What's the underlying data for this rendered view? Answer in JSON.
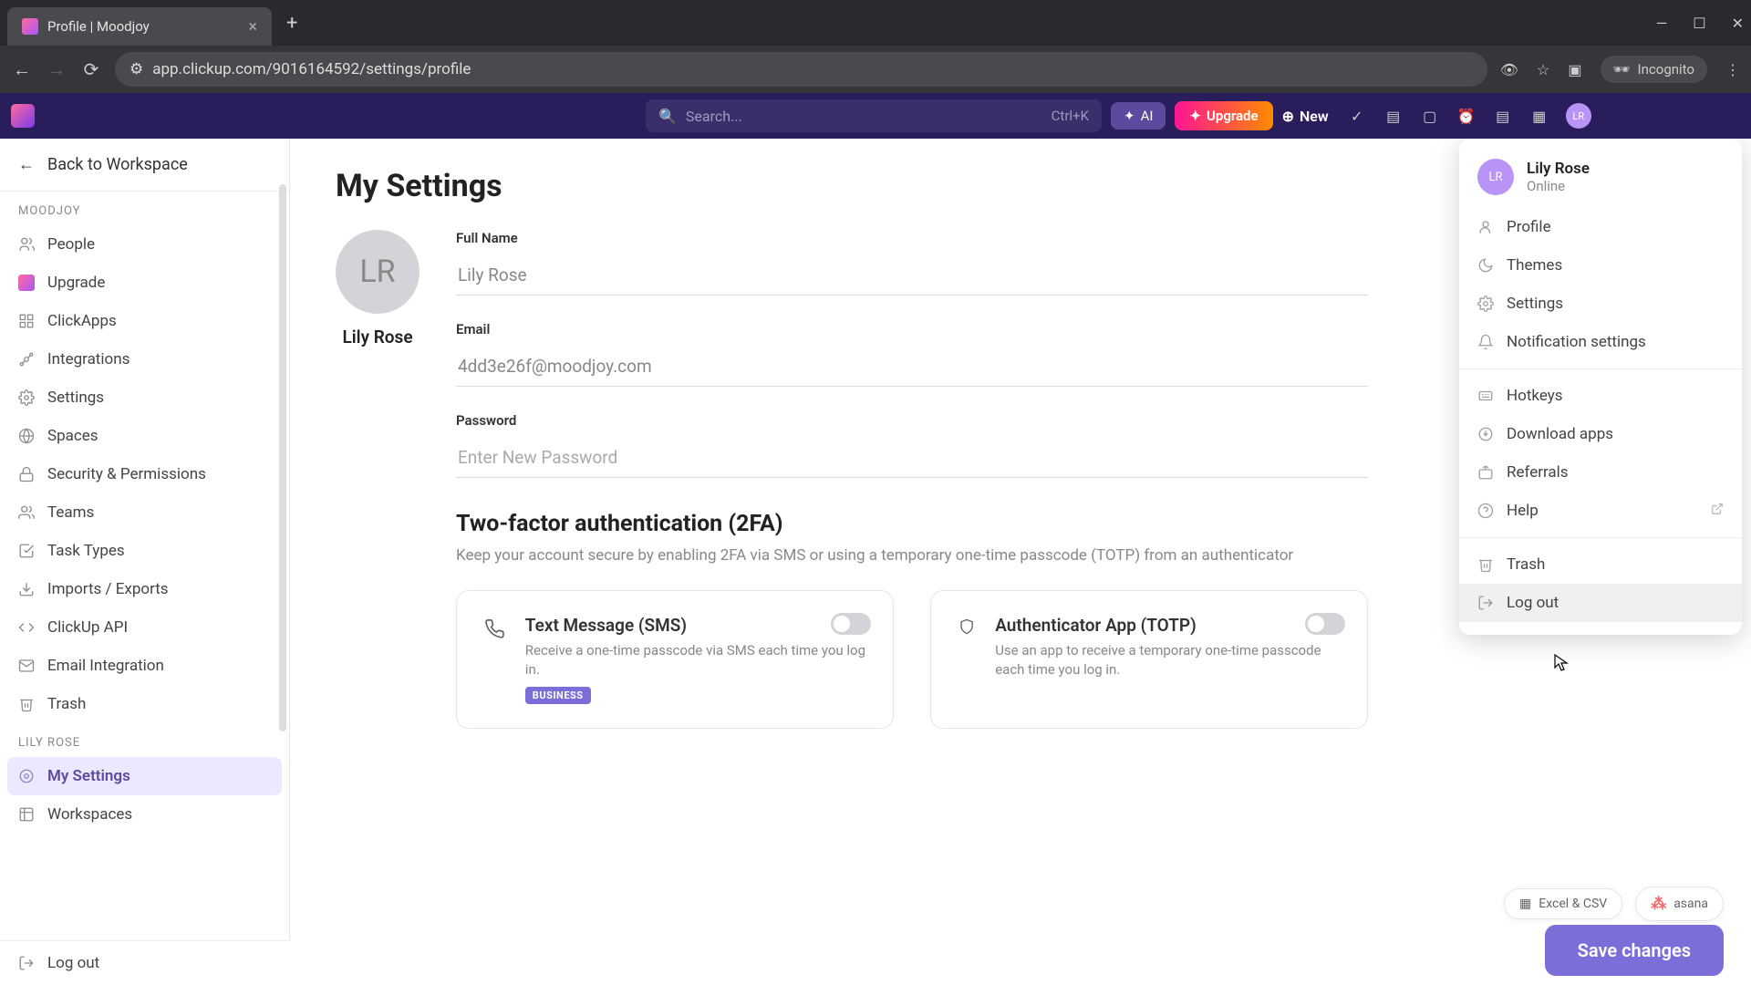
{
  "browser": {
    "tab_title": "Profile | Moodjoy",
    "url": "app.clickup.com/9016164592/settings/profile",
    "incognito_label": "Incognito"
  },
  "topbar": {
    "search_placeholder": "Search...",
    "search_shortcut": "Ctrl+K",
    "ai_label": "AI",
    "upgrade_label": "Upgrade",
    "new_label": "New",
    "avatar_initials": "LR"
  },
  "sidebar": {
    "back_label": "Back to Workspace",
    "section1_title": "MOODJOY",
    "section1_items": [
      {
        "icon": "people",
        "label": "People"
      },
      {
        "icon": "upgrade",
        "label": "Upgrade"
      },
      {
        "icon": "clickapps",
        "label": "ClickApps"
      },
      {
        "icon": "integrations",
        "label": "Integrations"
      },
      {
        "icon": "settings",
        "label": "Settings"
      },
      {
        "icon": "spaces",
        "label": "Spaces"
      },
      {
        "icon": "security",
        "label": "Security & Permissions"
      },
      {
        "icon": "teams",
        "label": "Teams"
      },
      {
        "icon": "task-types",
        "label": "Task Types"
      },
      {
        "icon": "imports",
        "label": "Imports / Exports"
      },
      {
        "icon": "api",
        "label": "ClickUp API"
      },
      {
        "icon": "email",
        "label": "Email Integration"
      },
      {
        "icon": "trash",
        "label": "Trash"
      }
    ],
    "section2_title": "LILY ROSE",
    "section2_items": [
      {
        "icon": "my-settings",
        "label": "My Settings",
        "active": true
      },
      {
        "icon": "workspaces",
        "label": "Workspaces"
      }
    ],
    "logout_label": "Log out"
  },
  "settings": {
    "page_title": "My Settings",
    "avatar_initials": "LR",
    "avatar_name": "Lily Rose",
    "fields": {
      "fullname_label": "Full Name",
      "fullname_value": "Lily Rose",
      "email_label": "Email",
      "email_value": "4dd3e26f@moodjoy.com",
      "password_label": "Password",
      "password_placeholder": "Enter New Password"
    },
    "twofa": {
      "title": "Two-factor authentication (2FA)",
      "description": "Keep your account secure by enabling 2FA via SMS or using a temporary one-time passcode (TOTP) from an authenticator",
      "sms_title": "Text Message (SMS)",
      "sms_desc": "Receive a one-time passcode via SMS each time you log in.",
      "sms_badge": "BUSINESS",
      "totp_title": "Authenticator App (TOTP)",
      "totp_desc": "Use an app to receive a temporary one-time passcode each time you log in."
    },
    "save_label": "Save changes",
    "excel_csv_label": "Excel & CSV",
    "asana_label": "asana"
  },
  "user_menu": {
    "avatar_initials": "LR",
    "name": "Lily Rose",
    "status": "Online",
    "items1": [
      {
        "icon": "profile",
        "label": "Profile"
      },
      {
        "icon": "themes",
        "label": "Themes"
      },
      {
        "icon": "settings",
        "label": "Settings"
      },
      {
        "icon": "notifications",
        "label": "Notification settings"
      }
    ],
    "items2": [
      {
        "icon": "hotkeys",
        "label": "Hotkeys"
      },
      {
        "icon": "download",
        "label": "Download apps"
      },
      {
        "icon": "referrals",
        "label": "Referrals"
      },
      {
        "icon": "help",
        "label": "Help",
        "external": true
      }
    ],
    "items3": [
      {
        "icon": "trash",
        "label": "Trash"
      },
      {
        "icon": "logout",
        "label": "Log out",
        "hovered": true
      }
    ]
  }
}
